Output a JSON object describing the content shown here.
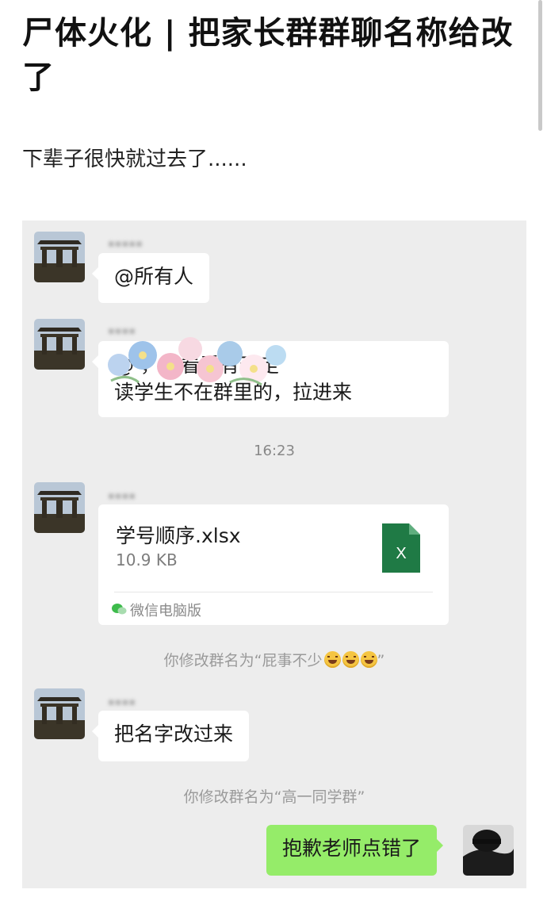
{
  "article": {
    "title": "尸体火化 | 把家长群群聊名称给改了",
    "subtitle": "下辈子很快就过去了......"
  },
  "chat": {
    "messages": [
      {
        "type": "text",
        "side": "left",
        "text": "@所有人"
      },
      {
        "type": "text",
        "side": "left",
        "text_line1": "@                ，你看看有无走",
        "text_line2": "读学生不在群里的，拉进来"
      },
      {
        "type": "time",
        "text": "16:23"
      },
      {
        "type": "file",
        "side": "left",
        "file_name": "学号顺序.xlsx",
        "file_size": "10.9 KB",
        "source": "微信电脑版",
        "icon": "excel-file-icon"
      },
      {
        "type": "system",
        "text": "你修改群名为“屁事不少",
        "emoji": "grinning-sweat-emoji",
        "text_end": "”"
      },
      {
        "type": "text",
        "side": "left",
        "text": "把名字改过来"
      },
      {
        "type": "system",
        "text": "你修改群名为“高一同学群”"
      },
      {
        "type": "text",
        "side": "right",
        "text": "抱歉老师点错了"
      }
    ]
  },
  "colors": {
    "chat_background": "#ededed",
    "bubble_received": "#ffffff",
    "bubble_sent": "#95ec69",
    "excel_green": "#1f7a45"
  }
}
